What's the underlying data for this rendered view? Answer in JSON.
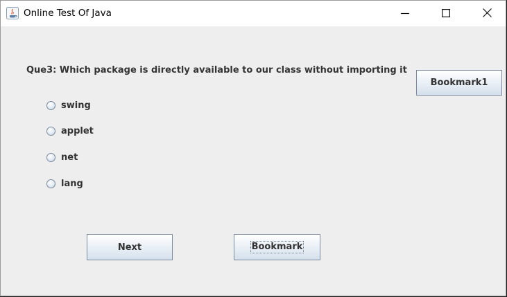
{
  "window": {
    "title": "Online Test Of Java"
  },
  "question": {
    "text": "Que3: Which package is directly available to our class without importing it"
  },
  "options": [
    {
      "label": "swing"
    },
    {
      "label": "applet"
    },
    {
      "label": "net"
    },
    {
      "label": "lang"
    }
  ],
  "buttons": {
    "bookmark1": "Bookmark1",
    "next": "Next",
    "bookmark": "Bookmark"
  }
}
